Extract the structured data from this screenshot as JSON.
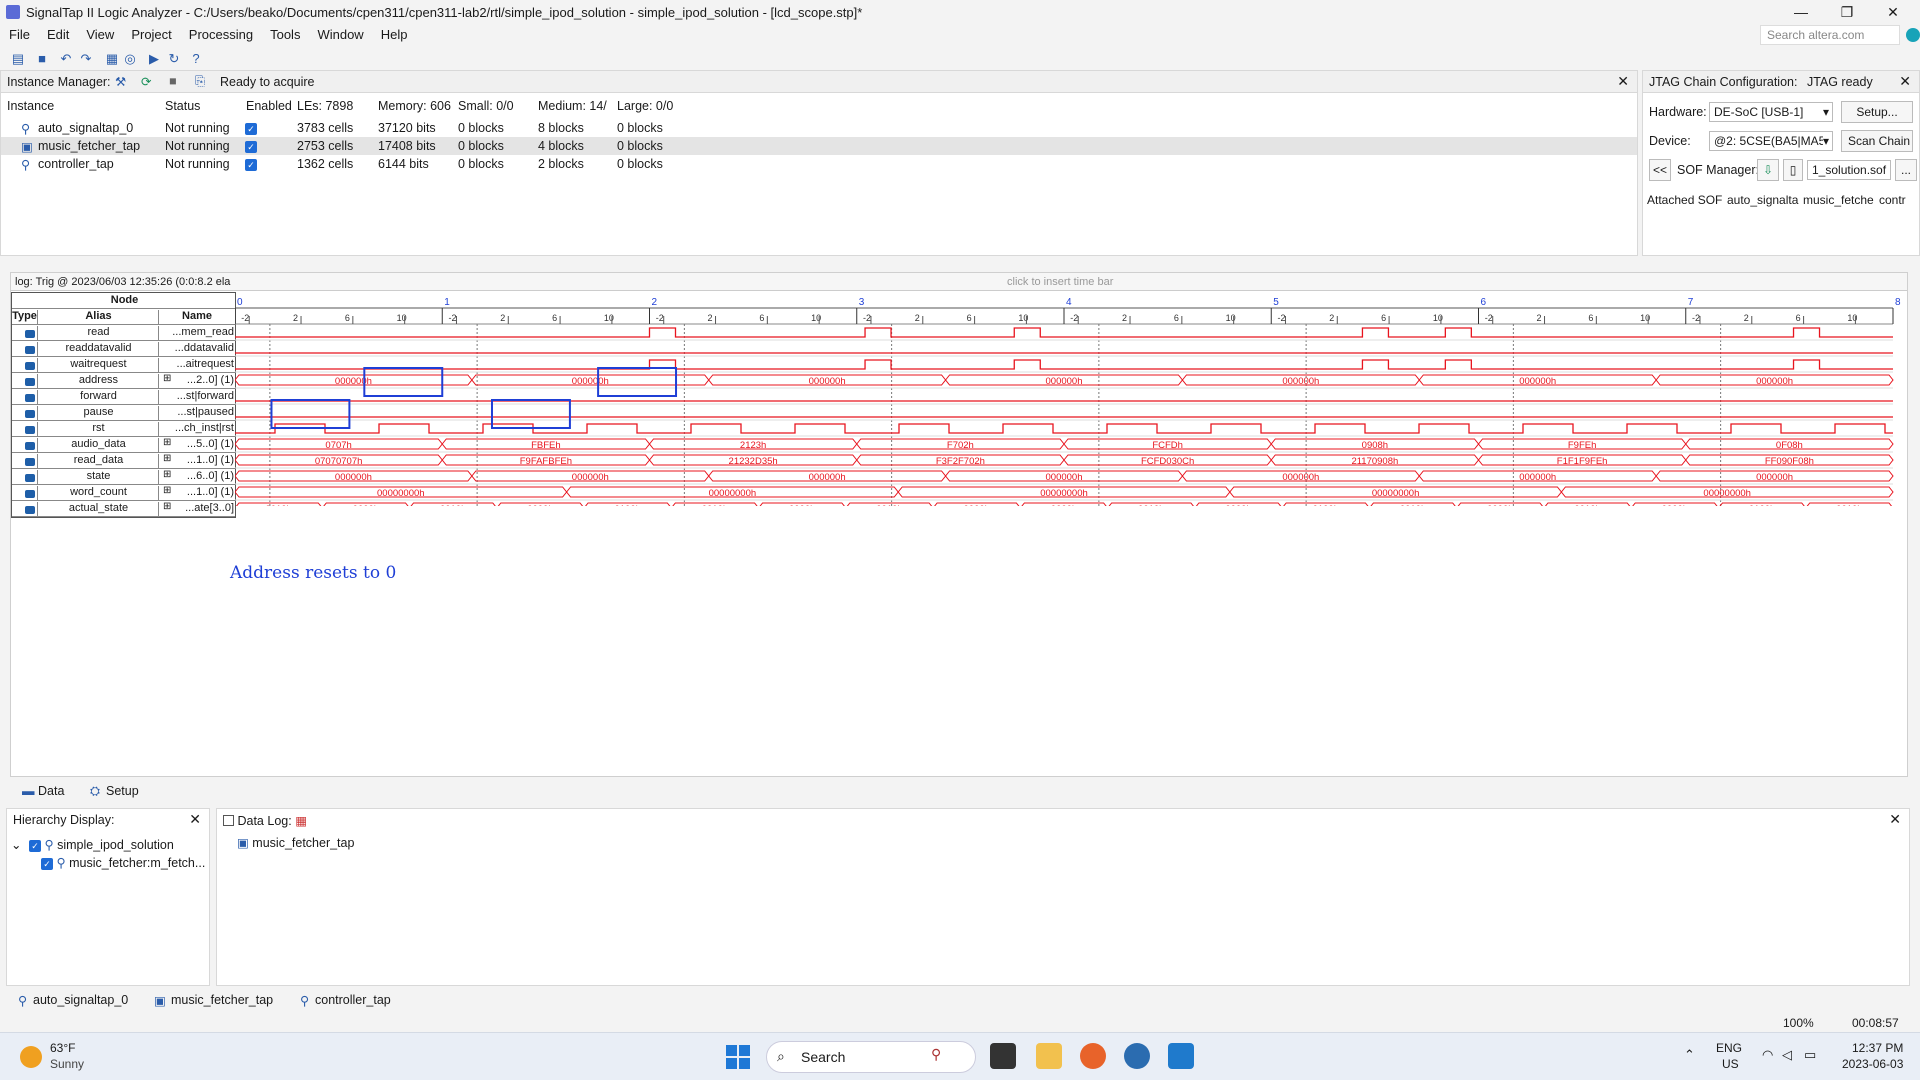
{
  "window": {
    "title": "SignalTap II Logic Analyzer - C:/Users/beako/Documents/cpen311/cpen311-lab2/rtl/simple_ipod_solution - simple_ipod_solution - [lcd_scope.stp]*"
  },
  "menu": [
    "File",
    "Edit",
    "View",
    "Project",
    "Processing",
    "Tools",
    "Window",
    "Help"
  ],
  "search_placeholder": "Search altera.com",
  "instance_manager": {
    "label": "Instance Manager:",
    "status": "Ready to acquire",
    "columns": [
      "Instance",
      "Status",
      "Enabled",
      "LEs: 7898",
      "Memory: 606",
      "Small: 0/0",
      "Medium: 14/",
      "Large: 0/0"
    ],
    "rows": [
      {
        "instance": "auto_signaltap_0",
        "status": "Not running",
        "les": "3783 cells",
        "memory": "37120 bits",
        "small": "0 blocks",
        "medium": "8 blocks",
        "large": "0 blocks"
      },
      {
        "instance": "music_fetcher_tap",
        "status": "Not running",
        "les": "2753 cells",
        "memory": "17408 bits",
        "small": "0 blocks",
        "medium": "4 blocks",
        "large": "0 blocks"
      },
      {
        "instance": "controller_tap",
        "status": "Not running",
        "les": "1362 cells",
        "memory": "6144 bits",
        "small": "0 blocks",
        "medium": "2 blocks",
        "large": "0 blocks"
      }
    ]
  },
  "jtag": {
    "label": "JTAG Chain Configuration:",
    "status": "JTAG ready",
    "hardware_label": "Hardware:",
    "hardware_value": "DE-SoC [USB-1]",
    "setup_btn": "Setup...",
    "device_label": "Device:",
    "device_value": "@2: 5CSE(BA5|MA5",
    "scan_btn": "Scan Chain",
    "back_btn": "<<",
    "sof_label": "SOF Manager:",
    "sof_file": "1_solution.sof",
    "more_btn": "...",
    "attached_cols": [
      "Attached SOF",
      "auto_signalta",
      "music_fetche",
      "contr"
    ]
  },
  "waveform": {
    "log_label": "log: Trig @ 2023/06/03 12:35:26 (0:0:8.2 ela",
    "insert_hint": "click to insert time bar",
    "header": {
      "node": "Node",
      "type": "Type",
      "alias": "Alias",
      "name": "Name"
    },
    "time_marks": [
      "0",
      "1",
      "2",
      "3",
      "4",
      "5",
      "6",
      "7",
      "8"
    ],
    "sub_ticks": [
      "-2",
      "2",
      "6",
      "10"
    ],
    "signals": [
      {
        "alias": "read",
        "name": "...mem_read"
      },
      {
        "alias": "readdatavalid",
        "name": "...ddatavalid"
      },
      {
        "alias": "waitrequest",
        "name": "...aitrequest"
      },
      {
        "alias": "address",
        "name": "...2..0] (1)",
        "bus": true
      },
      {
        "alias": "forward",
        "name": "...st|forward"
      },
      {
        "alias": "pause",
        "name": "...st|paused"
      },
      {
        "alias": "rst",
        "name": "...ch_inst|rst"
      },
      {
        "alias": "audio_data",
        "name": "...5..0] (1)",
        "bus": true
      },
      {
        "alias": "read_data",
        "name": "...1..0] (1)",
        "bus": true
      },
      {
        "alias": "state",
        "name": "...6..0] (1)",
        "bus": true
      },
      {
        "alias": "word_count",
        "name": "...1..0] (1)",
        "bus": true
      },
      {
        "alias": "actual_state",
        "name": "...ate[3..0]",
        "bus": true
      }
    ],
    "bus_values": {
      "address": [
        "000000h",
        "000000h",
        "000000h",
        "000000h",
        "000000h",
        "000000h",
        "000000h"
      ],
      "audio_data": [
        "0707h",
        "FBFEh",
        "2123h",
        "F702h",
        "FCFDh",
        "0908h",
        "F9FEh",
        "0F08h"
      ],
      "read_data": [
        "07070707h",
        "F9FAFBFEh",
        "21232D35h",
        "F3F2F702h",
        "FCFD030Ch",
        "21170908h",
        "F1F1F9FEh",
        "FF090F08h"
      ],
      "state": [
        "000000h",
        "000000h",
        "000000h",
        "000000h",
        "000000h",
        "000000h",
        "000000h"
      ],
      "word_count": [
        "00000000h",
        "00000000h",
        "00000000h",
        "00000000h",
        "00000000h"
      ],
      "actual_state": [
        "0010b",
        "0000b",
        "0010b",
        "0000b",
        "0100b",
        "0010b",
        "0000b",
        "0010b",
        "0000b",
        "0000b",
        "0010b",
        "0000b",
        "0100b",
        "0010b",
        "0000b",
        "0010b",
        "0000b",
        "0100b",
        "0010b"
      ]
    },
    "annotation": "Address resets to 0"
  },
  "view_tabs": [
    "Data",
    "Setup"
  ],
  "hierarchy": {
    "label": "Hierarchy Display:",
    "items": [
      "simple_ipod_solution",
      "music_fetcher:m_fetch..."
    ]
  },
  "datalog": {
    "label": "Data Log:",
    "item": "music_fetcher_tap"
  },
  "instance_tabs": [
    "auto_signaltap_0",
    "music_fetcher_tap",
    "controller_tap"
  ],
  "statusbar": {
    "zoom": "100%",
    "time": "00:08:57"
  },
  "taskbar": {
    "weather_temp": "63°F",
    "weather_desc": "Sunny",
    "search": "Search",
    "lang": "ENG",
    "region": "US",
    "clock_time": "12:37 PM",
    "clock_date": "2023-06-03"
  },
  "colors": {
    "wave": "#e8141e",
    "annotation": "#1f3fd6",
    "accent": "#1e6bd6"
  }
}
